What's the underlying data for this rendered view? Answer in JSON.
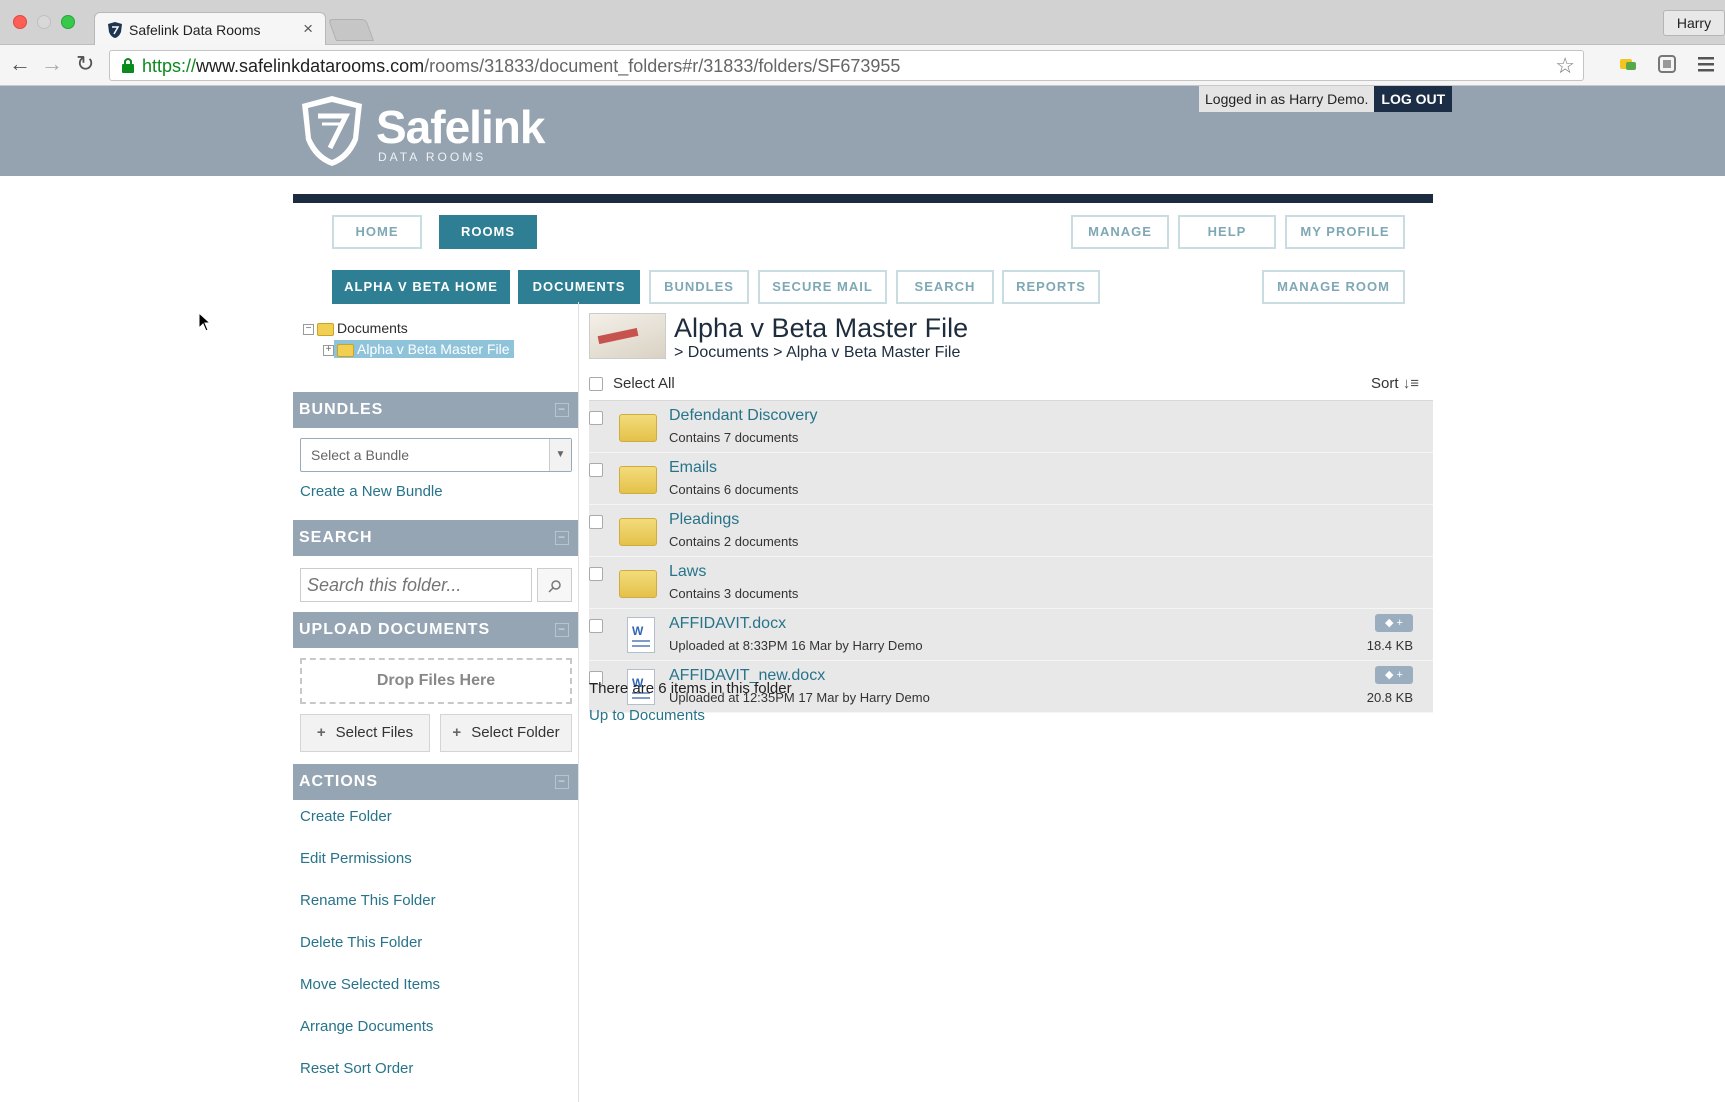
{
  "browser": {
    "tab_title": "Safelink Data Rooms",
    "user": "Harry",
    "url_scheme": "https://",
    "url_host": "www.safelinkdatarooms.com",
    "url_path": "/rooms/31833/document_folders#r/31833/folders/SF673955"
  },
  "header": {
    "logo_name": "Safelink",
    "logo_sub": "DATA ROOMS",
    "logged_in": "Logged in as Harry Demo.",
    "logout": "LOG OUT"
  },
  "nav": {
    "home": "HOME",
    "rooms": "ROOMS",
    "manage": "MANAGE",
    "help": "HELP",
    "my_profile": "MY PROFILE"
  },
  "subnav": {
    "room_home": "ALPHA V BETA HOME",
    "documents": "DOCUMENTS",
    "bundles": "BUNDLES",
    "secure_mail": "SECURE MAIL",
    "search": "SEARCH",
    "reports": "REPORTS",
    "manage_room": "MANAGE ROOM"
  },
  "tree": {
    "root": "Documents",
    "child": "Alpha v Beta Master File"
  },
  "sidebar": {
    "bundles": {
      "heading": "BUNDLES",
      "select_placeholder": "Select a Bundle",
      "create": "Create a New Bundle"
    },
    "search": {
      "heading": "SEARCH",
      "placeholder": "Search this folder..."
    },
    "upload": {
      "heading": "UPLOAD DOCUMENTS",
      "drop": "Drop Files Here",
      "select_files": "Select Files",
      "select_folder": "Select Folder"
    },
    "actions": {
      "heading": "ACTIONS",
      "items": [
        "Create Folder",
        "Edit Permissions",
        "Rename This Folder",
        "Delete This Folder",
        "Move Selected Items",
        "Arrange Documents",
        "Reset Sort Order"
      ]
    }
  },
  "main": {
    "title": "Alpha v Beta Master File",
    "breadcrumb": "> Documents > Alpha v Beta Master File",
    "select_all": "Select All",
    "sort": "Sort",
    "items": [
      {
        "type": "folder",
        "name": "Defendant Discovery",
        "meta": "Contains 7 documents",
        "size": ""
      },
      {
        "type": "folder",
        "name": "Emails",
        "meta": "Contains 6 documents",
        "size": ""
      },
      {
        "type": "folder",
        "name": "Pleadings",
        "meta": "Contains 2 documents",
        "size": ""
      },
      {
        "type": "folder",
        "name": "Laws",
        "meta": "Contains 3 documents",
        "size": ""
      },
      {
        "type": "doc",
        "name": "AFFIDAVIT.docx",
        "meta": "Uploaded at 8:33PM 16 Mar by Harry Demo",
        "size": "18.4 KB"
      },
      {
        "type": "doc",
        "name": "AFFIDAVIT_new.docx",
        "meta": "Uploaded at 12:35PM 17 Mar by Harry Demo",
        "size": "20.8 KB"
      }
    ],
    "count_text": "There are 6 items in this folder",
    "up_link": "Up to Documents"
  },
  "colors": {
    "header_bg": "#95a3b0",
    "accent": "#2e7f93",
    "link": "#27748a",
    "dark_bar": "#1b2b40"
  }
}
